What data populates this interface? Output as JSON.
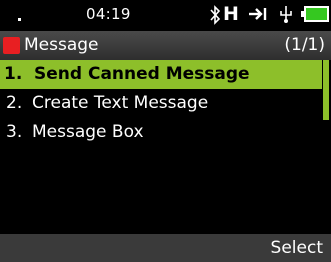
{
  "status": {
    "time": "04:19",
    "network_label": "H",
    "battery_color": "#35c820"
  },
  "title_bar": {
    "title": "Message",
    "page_indicator": "(1/1)",
    "icon_color": "#e81f22"
  },
  "menu": {
    "items": [
      {
        "number": "1.",
        "label": "Send Canned Message",
        "selected": true
      },
      {
        "number": "2.",
        "label": "Create Text Message",
        "selected": false
      },
      {
        "number": "3.",
        "label": "Message Box",
        "selected": false
      }
    ],
    "highlight_color": "#8dbf2a"
  },
  "softkeys": {
    "right": "Select"
  }
}
